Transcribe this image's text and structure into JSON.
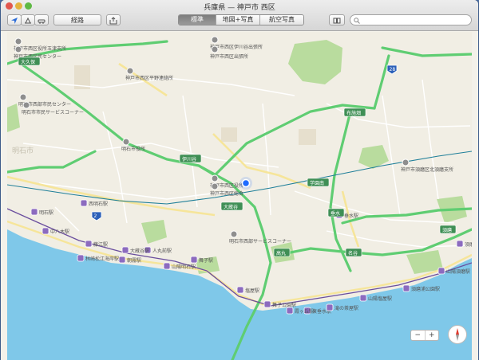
{
  "window": {
    "title": "兵庫県 — 神戸市 西区"
  },
  "toolbar": {
    "directions_label": "経路",
    "segments": [
      "標準",
      "地図+写真",
      "航空写真"
    ],
    "selected_segment": "標準",
    "search_placeholder": "",
    "icons": {
      "location": "location-arrow-icon",
      "three_d": "3d-view-icon",
      "traffic": "car-icon",
      "share": "share-icon",
      "bookmarks": "book-icon",
      "search": "search-icon"
    }
  },
  "map": {
    "city_label": "明石市",
    "facilities": [
      "神戸市西区役所玉津支所",
      "神戸市西区民センター",
      "神戸市西区伊川谷出張所",
      "神戸市西区平野連絡所",
      "明石市西部市民センター",
      "明石市役所",
      "神戸市西区役所",
      "神戸市西区総合",
      "神戸市西区出張所",
      "明石市西部サービスコーナー",
      "神戸市須磨区北須磨支所",
      "明石市市民サービスコーナー"
    ],
    "stations": [
      "西明石駅",
      "朝霧駅",
      "舞子駅",
      "垂水駅",
      "塩屋駅",
      "須磨駅",
      "明石駅",
      "山陽明石駅",
      "人丸前駅",
      "藤江駅",
      "中八木駅",
      "東垂水駅",
      "舞子公園駅",
      "霞ヶ丘駅",
      "滝の茶屋駅",
      "山陽塩屋駅",
      "須磨浦公園駅",
      "山陽須磨駅",
      "大蔵谷駅",
      "林崎松江海岸駅"
    ],
    "interchange_shields": [
      "大久保",
      "伊川谷",
      "布施畑",
      "学園南",
      "垂水",
      "大蔵谷",
      "高丸",
      "名谷",
      "須磨"
    ],
    "route_shields": [
      "2",
      "28"
    ],
    "colors": {
      "expressway": "#5fcd72",
      "major_road": "#f6e59a",
      "rail": "#1f7f99",
      "water": "#7fc8e9",
      "park": "#b9dc9e",
      "land": "#f1eee4",
      "user_location": "#1e6bff"
    }
  },
  "controls": {
    "zoom_out": "−",
    "zoom_in": "+",
    "compass": "compass-icon"
  }
}
